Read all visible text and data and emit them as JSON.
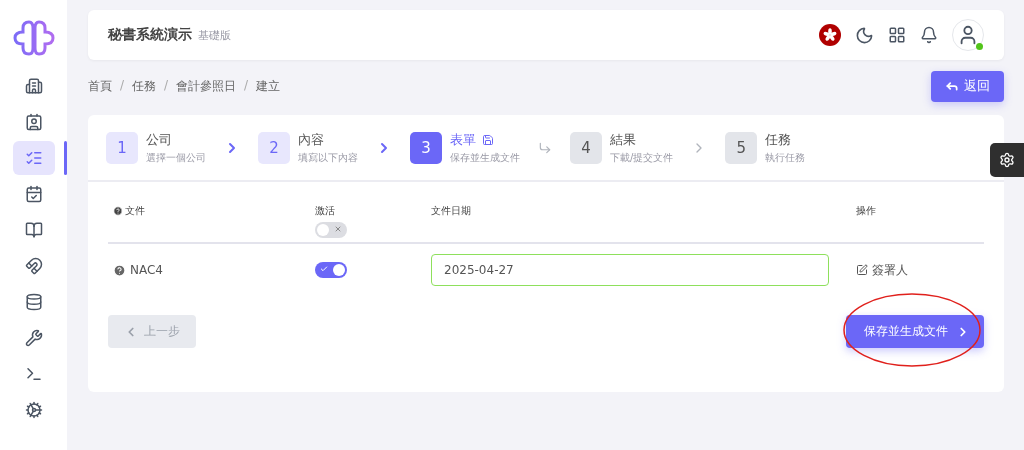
{
  "sidebar": {
    "items": [
      {
        "selected": false
      },
      {
        "selected": false
      },
      {
        "selected": true
      },
      {
        "selected": false
      },
      {
        "selected": false
      },
      {
        "selected": false
      },
      {
        "selected": false
      },
      {
        "selected": false
      },
      {
        "selected": false
      },
      {
        "selected": false
      }
    ]
  },
  "header": {
    "title": "秘書系統演示",
    "edition": "基礎版",
    "user_online": true
  },
  "breadcrumb": {
    "items": [
      "首頁",
      "任務",
      "會計參照日",
      "建立"
    ],
    "separator": "/"
  },
  "back_button": "返回",
  "steps": [
    {
      "number": "1",
      "title": "公司",
      "subtitle": "選擇一個公司",
      "completed": true,
      "selected": false
    },
    {
      "number": "2",
      "title": "內容",
      "subtitle": "填寫以下內容",
      "completed": true,
      "selected": false
    },
    {
      "number": "3",
      "title": "表單",
      "subtitle": "保存並生成文件",
      "completed": false,
      "selected": true
    },
    {
      "number": "4",
      "title": "結果",
      "subtitle": "下載/提交文件",
      "completed": false,
      "selected": false
    },
    {
      "number": "5",
      "title": "任務",
      "subtitle": "執行任務",
      "completed": false,
      "selected": false
    }
  ],
  "table": {
    "columns": [
      {
        "label": "文件",
        "kind": "help"
      },
      {
        "label": "激活",
        "kind": "toggle",
        "on": false
      },
      {
        "label": "文件日期",
        "kind": "plain"
      },
      {
        "label": "操作",
        "kind": "plain"
      }
    ],
    "rows": [
      {
        "name": "NAC4",
        "active": true,
        "date": "2025-04-27",
        "action": "簽署人"
      }
    ]
  },
  "prev_button": {
    "label": "上一步",
    "disabled": true
  },
  "next_button": {
    "label": "保存並生成文件",
    "highlighted": true
  }
}
